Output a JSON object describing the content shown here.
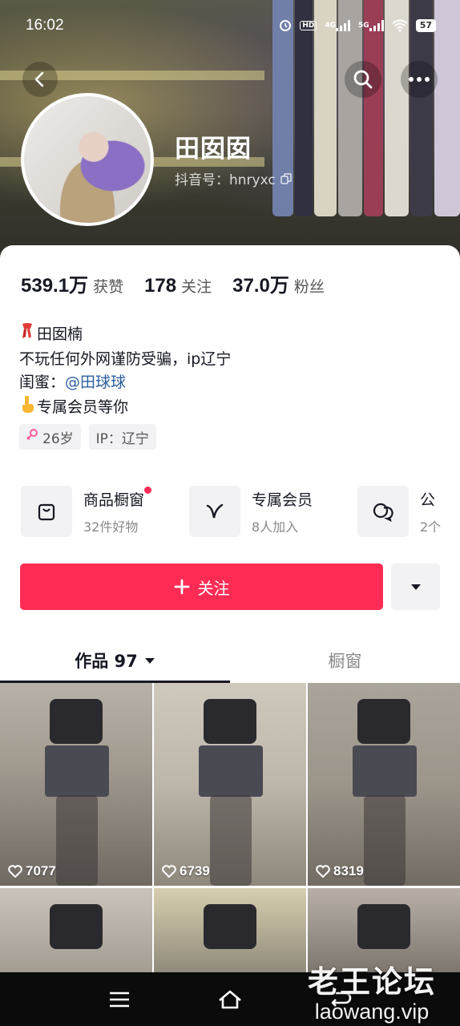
{
  "status_bar": {
    "time": "16:02",
    "hd_label": "HD",
    "signal1": "4G",
    "signal2": "5G",
    "battery": "57"
  },
  "profile": {
    "name": "田囡囡",
    "douyin_id": "抖音号：hnryxc"
  },
  "stats": [
    {
      "value": "539.1万",
      "label": "获赞"
    },
    {
      "value": "178",
      "label": "关注"
    },
    {
      "value": "37.0万",
      "label": "粉丝"
    }
  ],
  "bio": {
    "line1": "田囡楠",
    "line2": "不玩任何外网谨防受骗，ip辽宁",
    "line3_prefix": "闺蜜：",
    "line3_mention": "@田球球",
    "line4": "专属会员等你"
  },
  "tags": {
    "age": "26岁",
    "ip": "IP：辽宁"
  },
  "features": [
    {
      "title": "商品橱窗",
      "sub": "32件好物",
      "icon": "bag-icon"
    },
    {
      "title": "专属会员",
      "sub": "8人加入",
      "icon": "vip-icon"
    },
    {
      "title": "公",
      "sub": "2个",
      "icon": "chat-icon"
    }
  ],
  "actions": {
    "follow_label": "关注"
  },
  "tabs": {
    "works_label": "作品 97",
    "showcase_label": "橱窗"
  },
  "posts": [
    {
      "likes": "7077"
    },
    {
      "likes": "6739"
    },
    {
      "likes": "8319"
    },
    {
      "likes": ""
    },
    {
      "likes": ""
    },
    {
      "likes": ""
    }
  ],
  "watermark": {
    "title": "老王论坛",
    "url": "laowang.vip"
  },
  "colors": {
    "accent": "#fe2c55",
    "mention": "#2b5f9e"
  }
}
